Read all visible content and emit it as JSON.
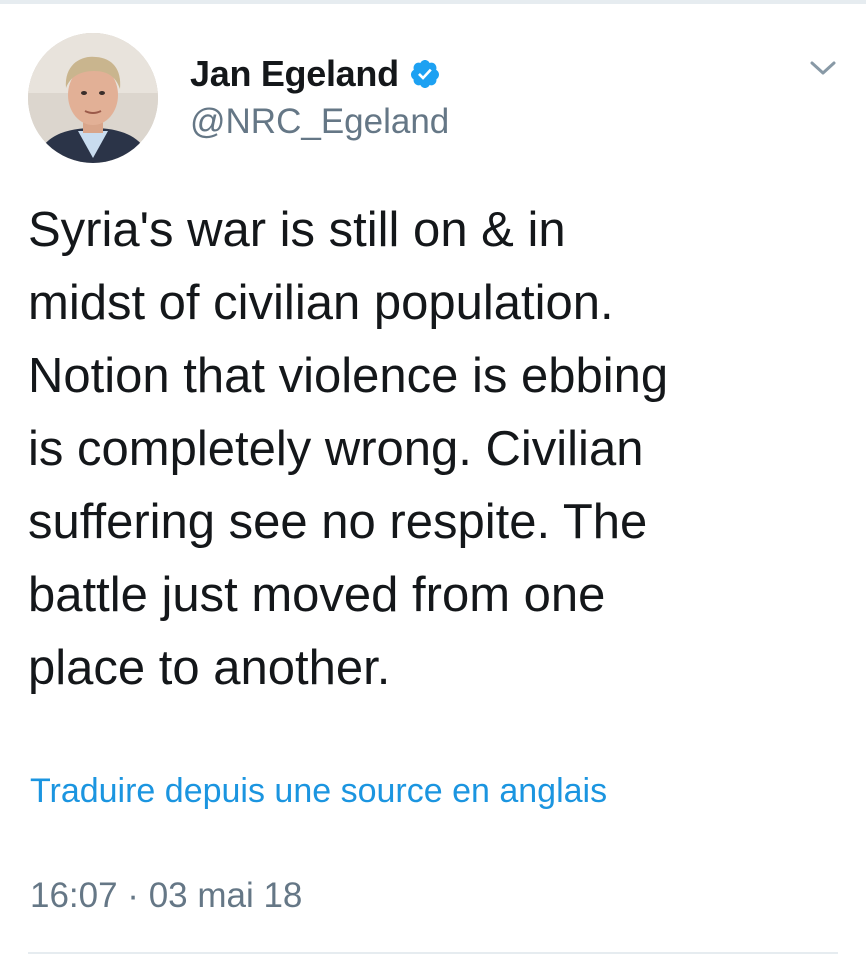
{
  "tweet": {
    "author": {
      "display_name": "Jan Egeland",
      "handle": "@NRC_Egeland",
      "verified": true,
      "avatar_icon": "profile-photo"
    },
    "menu_icon": "chevron-down-icon",
    "text": "Syria's war is still on & in\nmidst of civilian population.\nNotion that violence is ebbing\nis completely wrong. Civilian\nsuffering see no respite. The\nbattle just moved from one\nplace to another.",
    "translate_link": "Traduire depuis une source en anglais",
    "timestamp": "16:07 · 03 mai 18"
  },
  "colors": {
    "link": "#1b95e0",
    "secondary_text": "#657786",
    "primary_text": "#14171a",
    "verified_badge": "#1da1f2",
    "divider": "#e6ecf0"
  }
}
